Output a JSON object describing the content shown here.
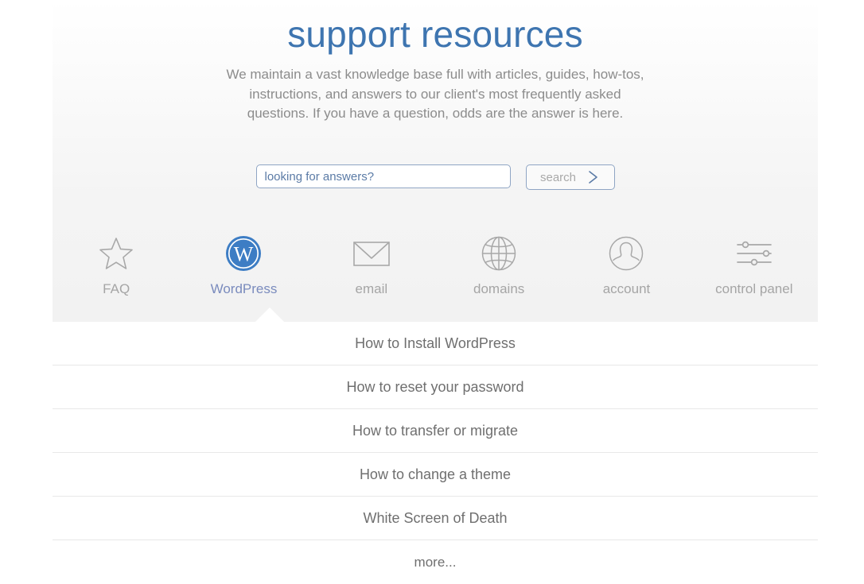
{
  "hero": {
    "title": "support resources",
    "subtitle": "We maintain a vast knowledge base full with articles, guides, how-tos, instructions, and answers to our client's most frequently asked questions. If you have a question, odds are the answer is here."
  },
  "search": {
    "placeholder": "looking for answers?",
    "value": "",
    "button_label": "search",
    "button_icon": "chevron-right-icon"
  },
  "categories": [
    {
      "label": "FAQ",
      "icon": "star-icon",
      "active": false
    },
    {
      "label": "WordPress",
      "icon": "wordpress-icon",
      "active": true
    },
    {
      "label": "email",
      "icon": "envelope-icon",
      "active": false
    },
    {
      "label": "domains",
      "icon": "globe-icon",
      "active": false
    },
    {
      "label": "account",
      "icon": "user-circle-icon",
      "active": false
    },
    {
      "label": "control panel",
      "icon": "sliders-icon",
      "active": false
    }
  ],
  "articles": [
    {
      "title": "How to Install WordPress"
    },
    {
      "title": "How to reset your password"
    },
    {
      "title": "How to transfer or migrate"
    },
    {
      "title": "How to change a theme"
    },
    {
      "title": "White Screen of Death"
    },
    {
      "title": "more..."
    }
  ],
  "colors": {
    "title_blue": "#3e75b0",
    "wordpress_blue": "#3d7dc4",
    "active_label": "#7a8bbd",
    "icon_gray": "#a8a8a8",
    "text_gray": "#6f6f6f",
    "border_blue": "#8fa5c4"
  }
}
